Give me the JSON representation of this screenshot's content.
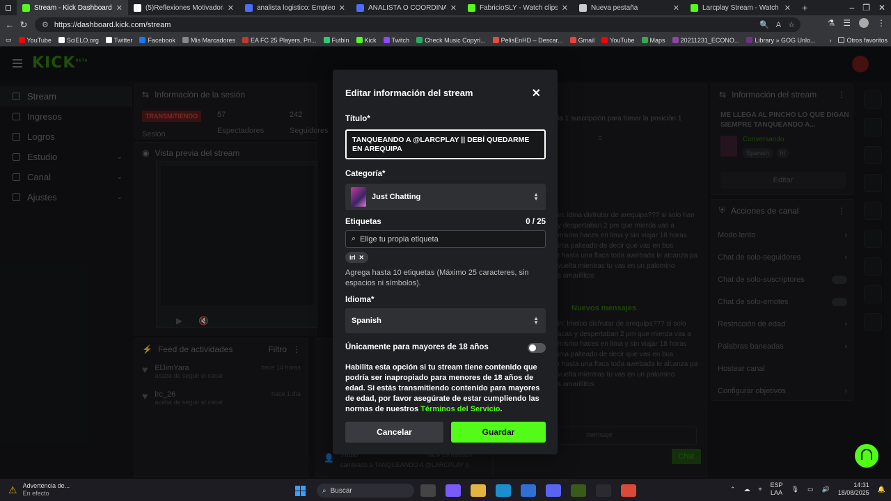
{
  "browser": {
    "tabs": [
      {
        "title": "Stream - Kick Dashboard",
        "active": true,
        "favicon": "kick-icon",
        "color": "#53fc18"
      },
      {
        "title": "(5)Reflexiones Motivadoras y Con",
        "favicon": "tiktok-icon",
        "color": "#ffffff"
      },
      {
        "title": "analista logistico: Empleos en Lin",
        "favicon": "linkedin-icon",
        "color": "#4a6cff"
      },
      {
        "title": "ANALISTA O COORDINADOR DE",
        "favicon": "linkedin-icon",
        "color": "#4a6cff"
      },
      {
        "title": "FabricioSLY - Watch clips on Kick",
        "favicon": "kick-icon",
        "color": "#53fc18"
      },
      {
        "title": "Nueva pestaña",
        "favicon": "page-icon",
        "color": "#cccccc"
      },
      {
        "title": "Larcplay Stream - Watch Live on",
        "favicon": "kick-icon",
        "color": "#53fc18"
      }
    ],
    "new_tab": "+",
    "url": "https://dashboard.kick.com/stream",
    "bookmarks": [
      {
        "label": "YouTube",
        "color": "#ff0000"
      },
      {
        "label": "SciELO.org",
        "color": "#ffffff"
      },
      {
        "label": "Twitter",
        "color": "#ffffff"
      },
      {
        "label": "Facebook",
        "color": "#1877f2"
      },
      {
        "label": "Mis Marcadores",
        "color": "#888888"
      },
      {
        "label": "EA FC 25 Players, Pri...",
        "color": "#c0392b"
      },
      {
        "label": "Futbin",
        "color": "#2ecc71"
      },
      {
        "label": "Kick",
        "color": "#53fc18"
      },
      {
        "label": "Twitch",
        "color": "#9146ff"
      },
      {
        "label": "Check Music Copyri...",
        "color": "#27ae60"
      },
      {
        "label": "PelisEnHD – Descar...",
        "color": "#e74c3c"
      },
      {
        "label": "Gmail",
        "color": "#ea4335"
      },
      {
        "label": "YouTube",
        "color": "#ff0000"
      },
      {
        "label": "Maps",
        "color": "#34a853"
      },
      {
        "label": "20211231_ECONO...",
        "color": "#8e44ad"
      },
      {
        "label": "Library » GOG Unlo...",
        "color": "#6c3483"
      }
    ],
    "other_bookmarks": "Otros favoritos"
  },
  "app": {
    "logo": "KICK",
    "logo_badge": "BETA",
    "sidebar": [
      {
        "label": "Stream",
        "icon": "stream-icon",
        "active": true
      },
      {
        "label": "Ingresos",
        "icon": "money-icon"
      },
      {
        "label": "Logros",
        "icon": "trophy-icon"
      },
      {
        "label": "Estudio",
        "icon": "studio-icon",
        "expandable": true
      },
      {
        "label": "Canal",
        "icon": "channel-icon",
        "expandable": true
      },
      {
        "label": "Ajustes",
        "icon": "gear-icon",
        "expandable": true
      }
    ],
    "session": {
      "title": "Información de la sesión",
      "status": "TRANSMITIENDO",
      "status_label": "Sesión",
      "viewers": "57",
      "viewers_label": "Espectadores",
      "followers": "242",
      "followers_label": "Seguidores"
    },
    "preview_title": "Vista previa del stream",
    "activity": {
      "title": "Feed de actividades",
      "filter": "Filtro",
      "items": [
        {
          "user": "ElJimYara",
          "text": "acaba de seguir el canal",
          "time": "hace 14 horas"
        },
        {
          "user": "lrc_26",
          "text": "acaba de seguir el canal",
          "time": "hace 1 día"
        }
      ],
      "title_change_label": "Título",
      "title_change_time": "hace 19 minutos",
      "title_change_text": "cambiado a TANQUEANDO A @LARCPLAY ||"
    },
    "chat": {
      "banner": "la 1 suscripción para tomar la posición 1",
      "msg1": [
        "in: Idina disfrutar de arequipa??? si solo han",
        "y despertaban 2 pm que mierda vas a",
        "mismo haces en lima y sin viajar 18 horas",
        "ima palteado de decir que vas en bus",
        "r hasta una flaca toda awebada le alcanza pa",
        "vuelta mientras tu vas en un palomino",
        "s amarillitos"
      ],
      "new_messages": "Nuevos mensajes",
      "msg2": [
        "in: lmelco disfrutar de arequipa??? si solo",
        "acas y despertaban 2 pm que mierda vas a",
        "mismo haces en lima y sin viajar 18 horas",
        "ima palteado de decir que vas en bus",
        "r hasta una flaca toda awebada le alcanza pa",
        "vuelta mientras tu vas en un palomino",
        "s amarillitos"
      ],
      "input_placeholder": "mensaje",
      "send": "Chat"
    },
    "stream_info": {
      "title": "Información del stream",
      "stream_title": "ME LLEGA AL PINCHO LO QUE DIGAN SIEMPRE TANQUEANDO A...",
      "category": "Conversando",
      "tags": [
        "Spanish",
        "Irl"
      ],
      "edit": "Editar"
    },
    "channel_actions": {
      "title": "Acciones de canal",
      "items": [
        {
          "label": "Modo lento",
          "control": "chevron"
        },
        {
          "label": "Chat de solo-seguidores",
          "control": "chevron"
        },
        {
          "label": "Chat de solo-suscriptores",
          "control": "toggle"
        },
        {
          "label": "Chat de solo-emotes",
          "control": "toggle"
        },
        {
          "label": "Restricción de edad",
          "control": "chevron"
        },
        {
          "label": "Palabras baneadas",
          "control": "chevron"
        },
        {
          "label": "Hostear canal",
          "control": "none"
        },
        {
          "label": "Configurar objetivos",
          "control": "chevron"
        }
      ]
    }
  },
  "modal": {
    "title": "Editar información del stream",
    "title_label": "Título*",
    "title_value": "TANQUEANDO A @LARCPLAY || DEBÍ QUEDARME EN AREQUIPA",
    "category_label": "Categoría*",
    "category_value": "Just Chatting",
    "tags_label": "Etiquetas",
    "tags_count": "0 / 25",
    "tags_placeholder": "Elige tu propia etiqueta",
    "tag_chip": "irl",
    "tags_help": "Agrega hasta 10 etiquetas (Máximo 25 caracteres, sin espacios ni símbolos).",
    "language_label": "Idioma*",
    "language_value": "Spanish",
    "mature_label": "Únicamente para mayores de 18 años",
    "mature_enabled": false,
    "mature_desc": "Habilita esta opción si tu stream tiene contenido que podría ser inapropiado para menores de 18 años de edad. Si estás transmitiendo contenido para mayores de edad, por favor asegúrate de estar cumpliendo las normas de nuestros",
    "terms_link": "Términos del Servicio",
    "terms_suffix": ".",
    "cancel": "Cancelar",
    "save": "Guardar",
    "accent": "#53fc18"
  },
  "taskbar": {
    "weather_title": "Advertencia de...",
    "weather_sub": "En efecto",
    "search": "Buscar",
    "lang": "ESP",
    "lang2": "LAA",
    "time": "14:31",
    "date": "18/08/2025"
  }
}
